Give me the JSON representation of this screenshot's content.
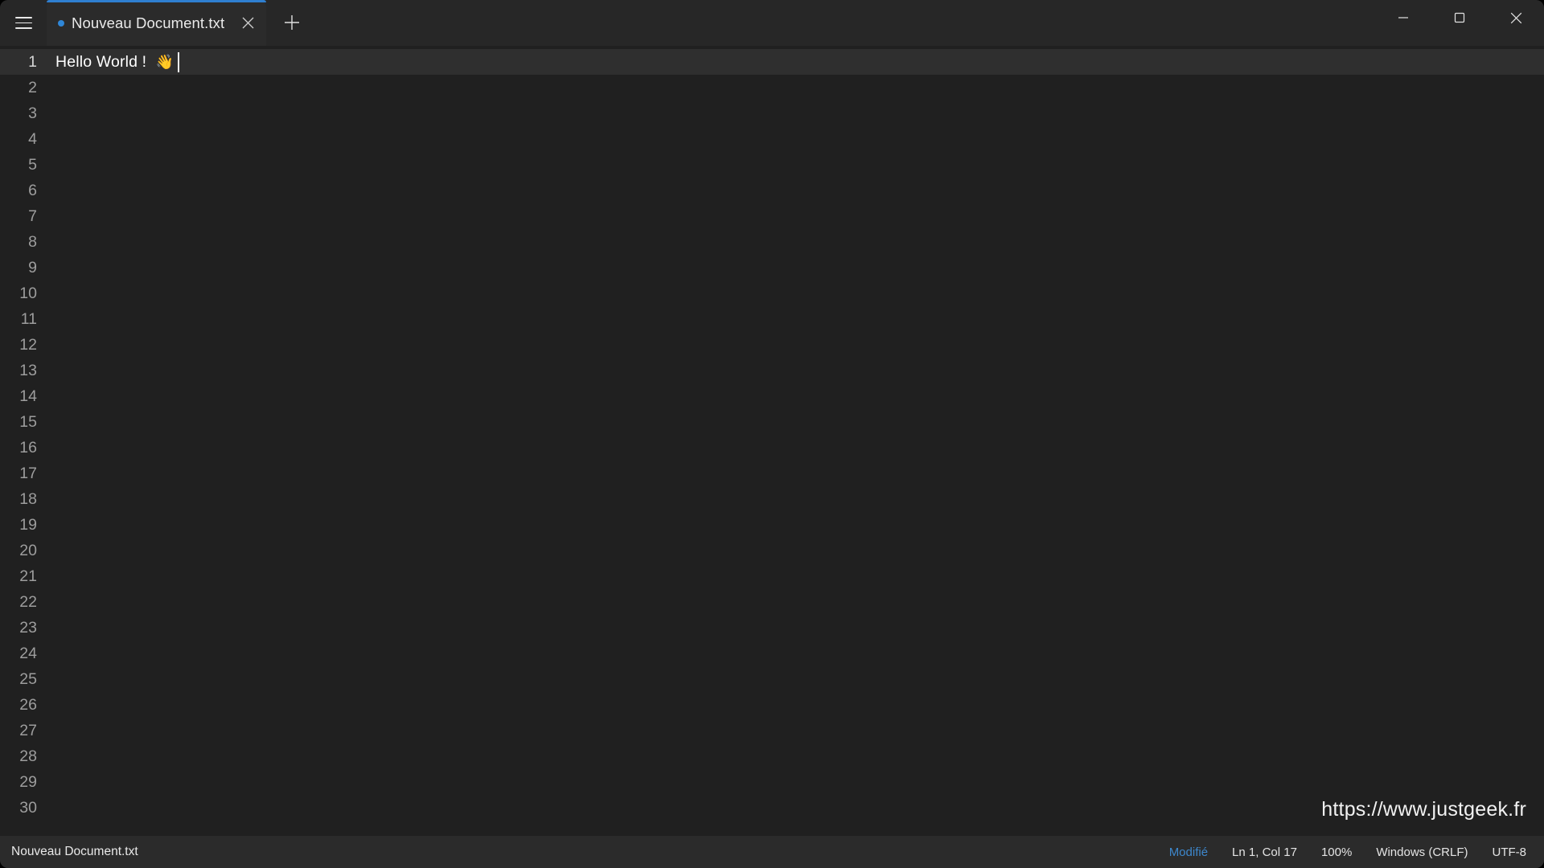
{
  "app": {
    "name": "Bloc-notes",
    "theme": "dark",
    "accent_color": "#2f87d8",
    "titlebar_bg": "#272727",
    "editor_bg": "#202020",
    "statusbar_bg": "#2b2b2b",
    "current_line_bg": "#2f2f2f"
  },
  "titlebar": {
    "menu_icon": "hamburger-icon",
    "tabs": [
      {
        "title": "Nouveau Document.txt",
        "modified_indicator": "•",
        "active": true,
        "close_icon": "close-icon"
      }
    ],
    "new_tab_icon": "plus-icon",
    "window_controls": {
      "minimize_icon": "minimize-icon",
      "maximize_icon": "maximize-icon",
      "close_icon": "close-icon"
    }
  },
  "editor": {
    "line_numbers": [
      "1",
      "2",
      "3",
      "4",
      "5",
      "6",
      "7",
      "8",
      "9",
      "10",
      "11",
      "12",
      "13",
      "14",
      "15",
      "16",
      "17",
      "18",
      "19",
      "20",
      "21",
      "22",
      "23",
      "24",
      "25",
      "26",
      "27",
      "28",
      "29",
      "30"
    ],
    "current_line": 1,
    "lines": [
      {
        "text": "Hello World ! ",
        "emoji": "👋",
        "caret_after": true
      }
    ],
    "watermark": "https://www.justgeek.fr"
  },
  "statusbar": {
    "filename": "Nouveau Document.txt",
    "modified_label": "Modifié",
    "cursor_position": "Ln 1, Col 17",
    "zoom_level": "100%",
    "line_ending": "Windows (CRLF)",
    "encoding": "UTF-8"
  }
}
